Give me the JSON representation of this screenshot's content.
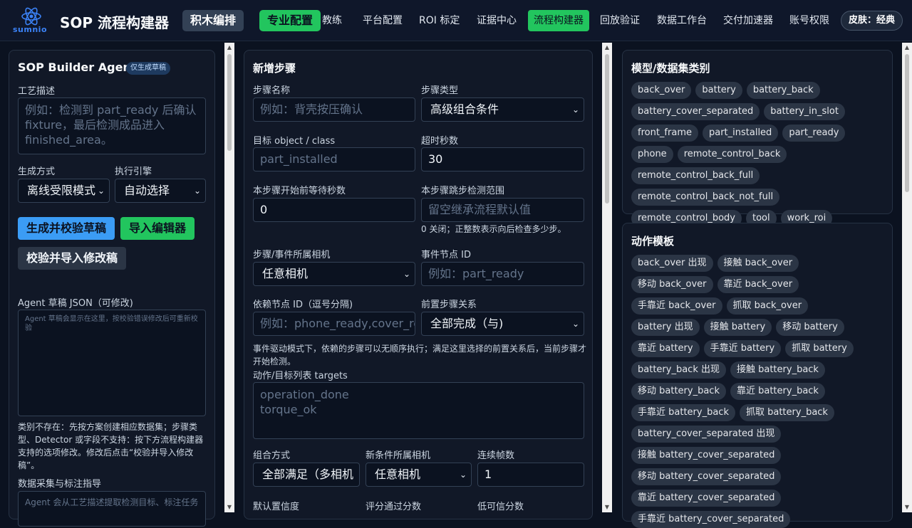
{
  "brand": {
    "logo_text": "sumnio",
    "title": "SOP 流程构建器"
  },
  "mode_buttons": [
    "积木编排",
    "专业配置"
  ],
  "nav": [
    "教练",
    "平台配置",
    "ROI 标定",
    "证据中心",
    "流程构建器",
    "回放验证",
    "数据工作台",
    "交付加速器",
    "账号权限"
  ],
  "skin_label": "皮肤：经典",
  "agent": {
    "title": "SOP Builder Agent",
    "badge": "仅生成草稿",
    "process_label": "工艺描述",
    "process_placeholder": "例如：检测到 part_ready 后确认 fixture，最后检测成品进入 finished_area。",
    "gen_mode_label": "生成方式",
    "gen_mode_value": "离线受限模式",
    "engine_label": "执行引擎",
    "engine_value": "自动选择",
    "btn_generate": "生成并校验草稿",
    "btn_import": "导入编辑器",
    "btn_validate_import": "校验并导入修改稿",
    "draft_label": "Agent 草稿 JSON（可修改)",
    "draft_placeholder": "Agent 草稿会显示在这里，按校验错误修改后可重新校验",
    "help_text": "类别不存在：先按方案创建相应数据集；步骤类型、Detector 或字段不支持：按下方流程构建器支持的选项修改。修改后点击“校验并导入修改稿”。",
    "guide_label": "数据采集与标注指导",
    "guide_placeholder": "Agent 会从工艺描述提取检测目标、标注任务"
  },
  "step": {
    "title": "新增步骤",
    "name_label": "步骤名称",
    "name_placeholder": "例如：背壳按压确认",
    "type_label": "步骤类型",
    "type_value": "高级组合条件",
    "target_label": "目标 object / class",
    "target_placeholder": "part_installed",
    "timeout_label": "超时秒数",
    "timeout_value": "30",
    "wait_label": "本步骤开始前等待秒数",
    "wait_value": "0",
    "skip_label": "本步骤跳步检测范围",
    "skip_placeholder": "留空继承流程默认值",
    "skip_hint": "0 关闭；正整数表示向后检查多少步。",
    "camera_label": "步骤/事件所属相机",
    "camera_value": "任意相机",
    "event_label": "事件节点 ID",
    "event_placeholder": "例如：part_ready",
    "deps_label": "依赖节点 ID（逗号分隔)",
    "deps_placeholder": "例如：phone_ready,cover_removed",
    "prev_label": "前置步骤关系",
    "prev_value": "全部完成（与)",
    "event_hint": "事件驱动模式下，依赖的步骤可以无顺序执行；满足这里选择的前置关系后，当前步骤才开始检测。",
    "targets_label": "动作/目标列表 targets",
    "targets_placeholder": [
      "operation_done",
      "torque_ok"
    ],
    "combine_label": "组合方式",
    "combine_value": "全部满足（多相机",
    "newcam_label": "新条件所属相机",
    "newcam_value": "任意相机",
    "frames_label": "连续帧数",
    "frames_value": "1",
    "conf_label": "默认置信度",
    "score_label": "评分通过分数",
    "low_label": "低可信分数"
  },
  "classes": {
    "title": "模型/数据集类别",
    "items": [
      "back_over",
      "battery",
      "battery_back",
      "battery_cover_separated",
      "battery_in_slot",
      "front_frame",
      "part_installed",
      "part_ready",
      "phone",
      "remote_control_back",
      "remote_control_back_full",
      "remote_control_back_not_full",
      "remote_control_body",
      "tool",
      "work_roi"
    ]
  },
  "actions": {
    "title": "动作模板",
    "items": [
      "back_over 出现",
      "接触 back_over",
      "移动 back_over",
      "靠近 back_over",
      "手靠近 back_over",
      "抓取 back_over",
      "battery 出现",
      "接触 battery",
      "移动 battery",
      "靠近 battery",
      "手靠近 battery",
      "抓取 battery",
      "battery_back 出现",
      "接触 battery_back",
      "移动 battery_back",
      "靠近 battery_back",
      "手靠近 battery_back",
      "抓取 battery_back",
      "battery_cover_separated 出现",
      "接触 battery_cover_separated",
      "移动 battery_cover_separated",
      "靠近 battery_cover_separated",
      "手靠近 battery_cover_separated"
    ]
  },
  "colors": {
    "accent_green": "#22c55e",
    "accent_blue": "#3b9cf5",
    "bg": "#0b1220",
    "panel": "#111827"
  }
}
